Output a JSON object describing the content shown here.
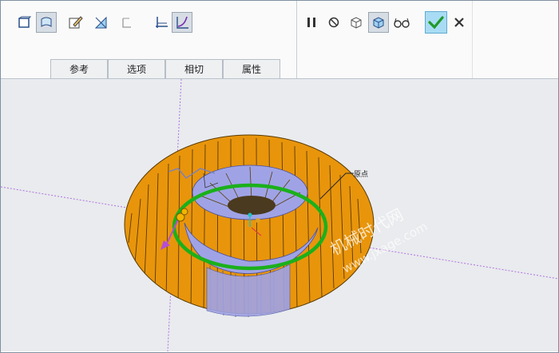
{
  "tabs": [
    {
      "label": "参考"
    },
    {
      "label": "选项"
    },
    {
      "label": "相切"
    },
    {
      "label": "属性"
    }
  ],
  "viewport": {
    "annotation_label": "原点",
    "watermark_line1": "机械时代网",
    "watermark_line2": "www.jxage.com"
  },
  "colors": {
    "ring": "#e8950c",
    "inner": "#9fa3e6",
    "trajectory": "#1bb01b",
    "datum": "#b34fd6",
    "confirm": "#1f9a2a"
  }
}
